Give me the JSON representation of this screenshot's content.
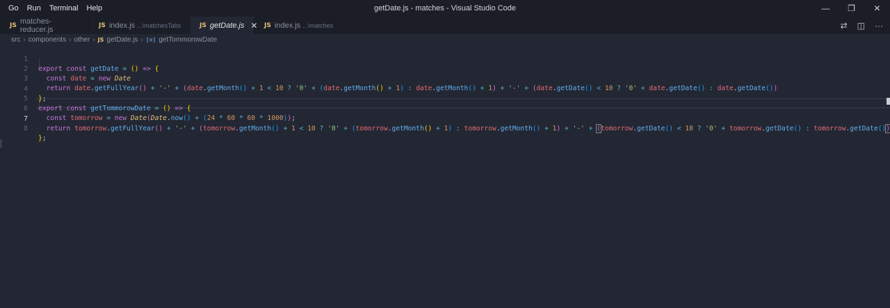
{
  "window": {
    "title": "getDate.js - matches - Visual Studio Code",
    "menu": [
      "Go",
      "Run",
      "Terminal",
      "Help"
    ],
    "controls": {
      "minimize": "—",
      "restore": "❐",
      "close": "✕"
    }
  },
  "tabs": [
    {
      "icon": "JS",
      "label": "matches-reducer.js",
      "description": "",
      "state": "normal"
    },
    {
      "icon": "JS",
      "label": "index.js",
      "description": "...\\matchesTabs",
      "state": "modified"
    },
    {
      "icon": "JS",
      "label": "getDate.js",
      "description": "",
      "state": "active"
    },
    {
      "icon": "JS",
      "label": "index.js",
      "description": "...\\matches",
      "state": "normal"
    }
  ],
  "tab_actions": {
    "compare": "⇄",
    "split": "◫",
    "more": "···"
  },
  "breadcrumb": {
    "items": [
      "src",
      "components",
      "other"
    ],
    "file_icon": "JS",
    "file": "getDate.js",
    "symbol_icon": "[⊙]",
    "symbol": "getTommorowDate"
  },
  "editor": {
    "current_line": 7,
    "line_numbers": [
      "1",
      "2",
      "3",
      "4",
      "5",
      "6",
      "7",
      "8"
    ]
  }
}
